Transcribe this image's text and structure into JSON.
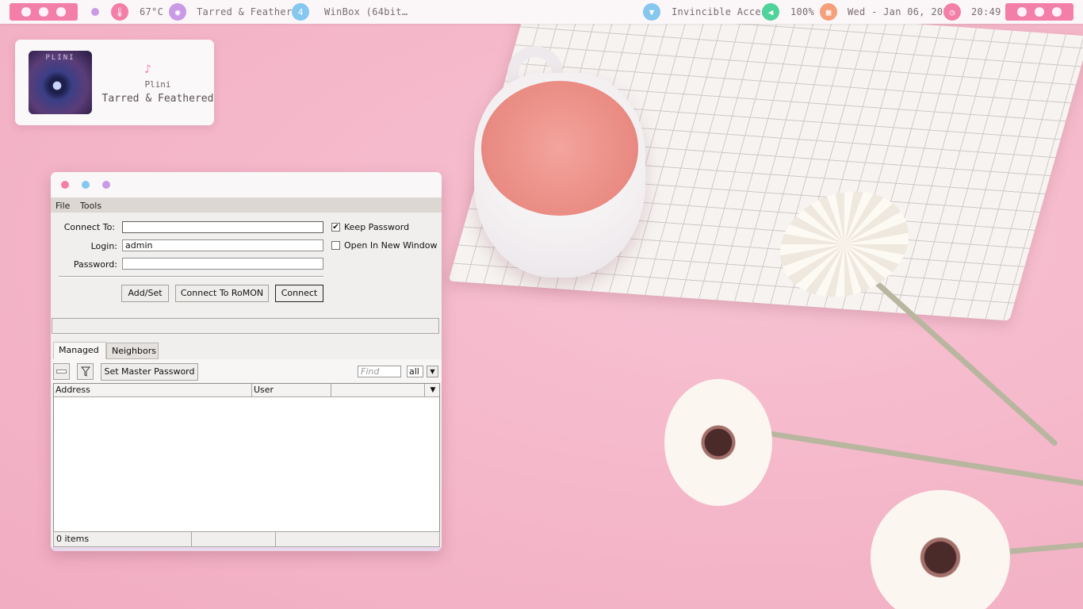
{
  "topbar": {
    "temperature": "67°C",
    "music_title": "Tarred & Feathered",
    "workspace_number": "4",
    "active_window": "WinBox (64bit…",
    "network": "Invincible Access",
    "volume": "100%",
    "date": "Wed - Jan 06, 2021",
    "time": "20:49",
    "colors": {
      "pink": "#f37fa8",
      "purple": "#c99ae6",
      "blue": "#85c7ef",
      "green": "#4fd39b",
      "orange": "#f4a07b"
    }
  },
  "music_widget": {
    "album_text": "PLINI",
    "artist": "Plini",
    "track": "Tarred & Feathered",
    "icon": "music-note-icon"
  },
  "winbox": {
    "menu": [
      "File",
      "Tools"
    ],
    "form": {
      "connect_to_label": "Connect To:",
      "connect_to_value": "",
      "login_label": "Login:",
      "login_value": "admin",
      "password_label": "Password:",
      "password_value": "",
      "keep_password_label": "Keep Password",
      "keep_password_checked": true,
      "open_new_window_label": "Open In New Window",
      "open_new_window_checked": false
    },
    "buttons": {
      "add_set": "Add/Set",
      "connect_romon": "Connect To RoMON",
      "connect": "Connect"
    },
    "tabs": {
      "managed": "Managed",
      "neighbors": "Neighbors"
    },
    "toolbar": {
      "set_master_password": "Set Master Password",
      "find_placeholder": "Find",
      "filter_value": "all"
    },
    "table": {
      "columns": [
        "Address",
        "User",
        ""
      ],
      "rows": []
    },
    "footer": {
      "count": "0 items"
    }
  }
}
